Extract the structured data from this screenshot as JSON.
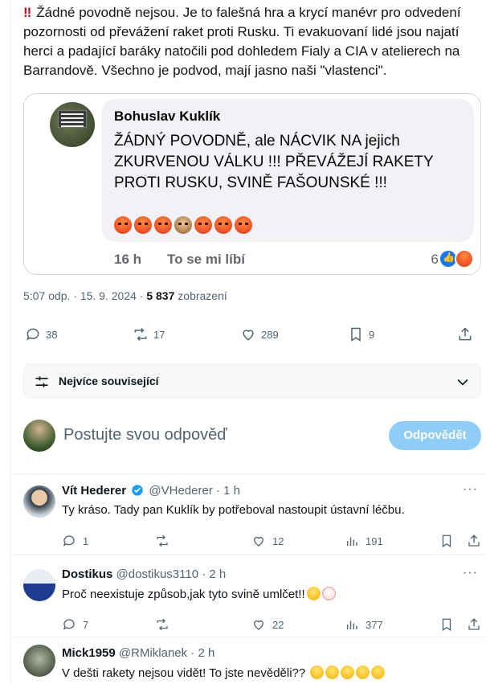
{
  "tweet": {
    "lead_icon": "double-exclamation",
    "text": "Žádné povodně nejsou. Je to falešná hra a krycí manévr pro odvedení pozornosti od převážení raket proti Rusku. Ti evakuovaní lidé jsou najatí herci a padající baráky natočili pod dohledem Fialy a CIA v atelierech na Barrandově. Všechno je podvod, mají jasno naši \"vlastenci\".",
    "time": "5:07 odp. · 15. 9. 2024 ·",
    "views_count": "5 837",
    "views_label": "zobrazení",
    "replies": "38",
    "reposts": "17",
    "likes": "289",
    "bookmarks": "9"
  },
  "quoted": {
    "author": "Bohuslav Kuklík",
    "body": "ŽÁDNÝ POVODNĚ, ale NÁCVIK NA jejich ZKURVENOU VÁLKU !!! PŘEVÁŽEJÍ RAKETY PROTI RUSKU, SVINĚ FAŠOUNSKÉ !!!",
    "emojis": [
      "angry",
      "angry",
      "angry",
      "see-no-evil-monkey",
      "angry",
      "angry",
      "angry"
    ],
    "age": "16 h",
    "like_action": "To se mi líbí",
    "reaction_count": "6"
  },
  "filter": {
    "label": "Nejvíce související"
  },
  "reply_box": {
    "placeholder": "Postujte svou odpověď",
    "button": "Odpovědět"
  },
  "comments": [
    {
      "name": "Vít Hederer",
      "verified": true,
      "handle": "@VHederer · 1 h",
      "text": "Ty kráso. Tady pan Kuklík by potřeboval nastoupit ústavní léčbu.",
      "emojis": [],
      "replies": "1",
      "reposts": "",
      "likes": "12",
      "views": "191"
    },
    {
      "name": "Dostikus",
      "verified": false,
      "handle": "@dostikus3110 · 2 h",
      "text": "Proč neexistuje způsob,jak tyto svině umlčet!!",
      "emojis": [
        "shocked-face",
        "clown-face"
      ],
      "replies": "7",
      "reposts": "",
      "likes": "22",
      "views": "377"
    },
    {
      "name": "Mick1959",
      "verified": false,
      "handle": "@RMiklanek · 2 h",
      "text": "V dešti rakety nejsou vidět! To jste nevěděli??",
      "emojis": [
        "flushed-face",
        "flushed-face",
        "joy-face",
        "joy-face",
        "joy-face"
      ]
    }
  ],
  "colors": {
    "accent": "#1d9bf0",
    "reply_button": "#8ecdf8",
    "muted": "#536471",
    "fb_bubble": "#f0f2f5"
  }
}
